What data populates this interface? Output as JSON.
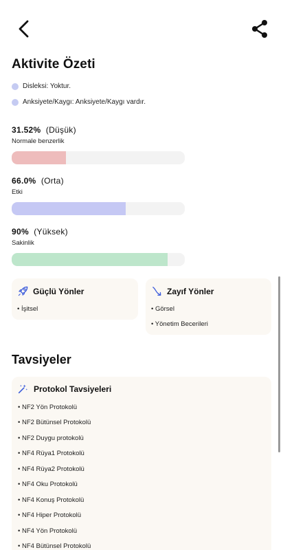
{
  "header": {
    "back_icon": "chevron-left-icon",
    "share_icon": "share-icon"
  },
  "title": "Aktivite Özeti",
  "statuses": [
    {
      "text": "Disleksi: Yoktur."
    },
    {
      "text": "Anksiyete/Kaygı: Anksiyete/Kaygı vardır."
    }
  ],
  "metrics": [
    {
      "value": "31.52%",
      "level": "(Düşük)",
      "label": "Normale benzerlik",
      "fraction": 0.3152,
      "color": "#eebcbc"
    },
    {
      "value": "66.0%",
      "level": "(Orta)",
      "label": "Etki",
      "fraction": 0.66,
      "color": "#c5c8f4"
    },
    {
      "value": "90%",
      "level": "(Yüksek)",
      "label": "Sakinlik",
      "fraction": 0.9,
      "color": "#bde6cb"
    }
  ],
  "strengths": {
    "title": "Güçlü Yönler",
    "icon": "rocket-icon",
    "items": [
      "• İşitsel"
    ]
  },
  "weaknesses": {
    "title": "Zayıf Yönler",
    "icon": "trend-down-icon",
    "items": [
      "• Görsel",
      "• Yönetim Becerileri"
    ]
  },
  "recommendations": {
    "section_title": "Tavsiyeler",
    "card_title": "Protokol Tavsiyeleri",
    "icon": "magic-wand-icon",
    "items": [
      "• NF2 Yön Protokolü",
      "• NF2 Bütünsel Protokolü",
      "• NF2 Duygu protokolü",
      "• NF4 Rüya1 Protokolü",
      "• NF4 Rüya2 Protokolü",
      "• NF4 Oku Protokolü",
      "• NF4 Konuş Protokolü",
      "• NF4 Hiper Protokolü",
      "• NF4 Yön Protokolü",
      "• NF4 Bütünsel Protokolü"
    ]
  }
}
